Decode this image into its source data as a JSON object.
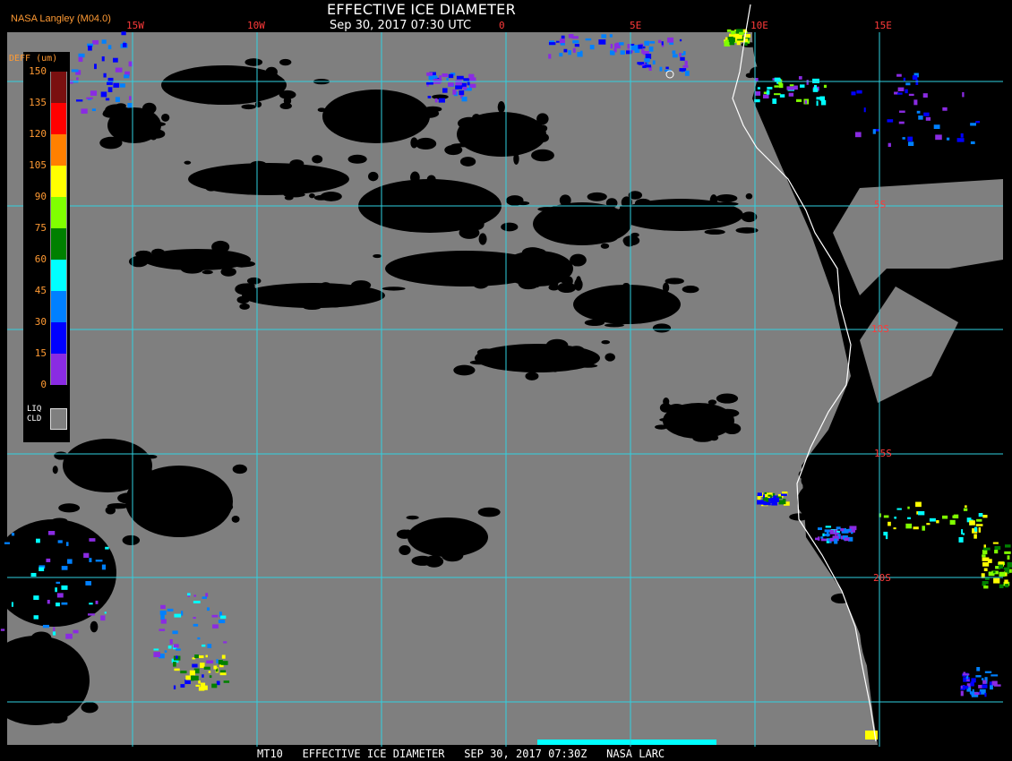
{
  "header": {
    "credit": "NASA Langley (M04.0)",
    "title": "EFFECTIVE ICE DIAMETER",
    "time": "Sep 30, 2017 07:30 UTC"
  },
  "lon_labels": [
    "15W",
    "10W",
    "5W",
    "0",
    "5E",
    "10E",
    "15E"
  ],
  "lat_labels": [
    "5S",
    "10S",
    "15S",
    "20S"
  ],
  "legend": {
    "title": "DEFF (um)",
    "ticks": [
      "150",
      "135",
      "120",
      "105",
      "90",
      "75",
      "60",
      "45",
      "30",
      "15",
      "0"
    ],
    "colors": [
      "#7a1010",
      "#ff0000",
      "#ff8000",
      "#ffff00",
      "#80ff00",
      "#008000",
      "#00ffff",
      "#0080ff",
      "#0000ff",
      "#8a2be2"
    ],
    "liq_label_1": "LIQ",
    "liq_label_2": "CLD",
    "liq_color": "#7f7f7f"
  },
  "footer": {
    "text": "MT10   EFFECTIVE ICE DIAMETER   SEP 30, 2017 07:30Z   NASA LARC"
  },
  "colors": {
    "background": "#000000",
    "cloud_gray": "#7f7f7f",
    "grid": "#30d0e0",
    "coastline": "#ffffff",
    "label_red": "#ff3a3a",
    "label_orange": "#ff9a33"
  }
}
